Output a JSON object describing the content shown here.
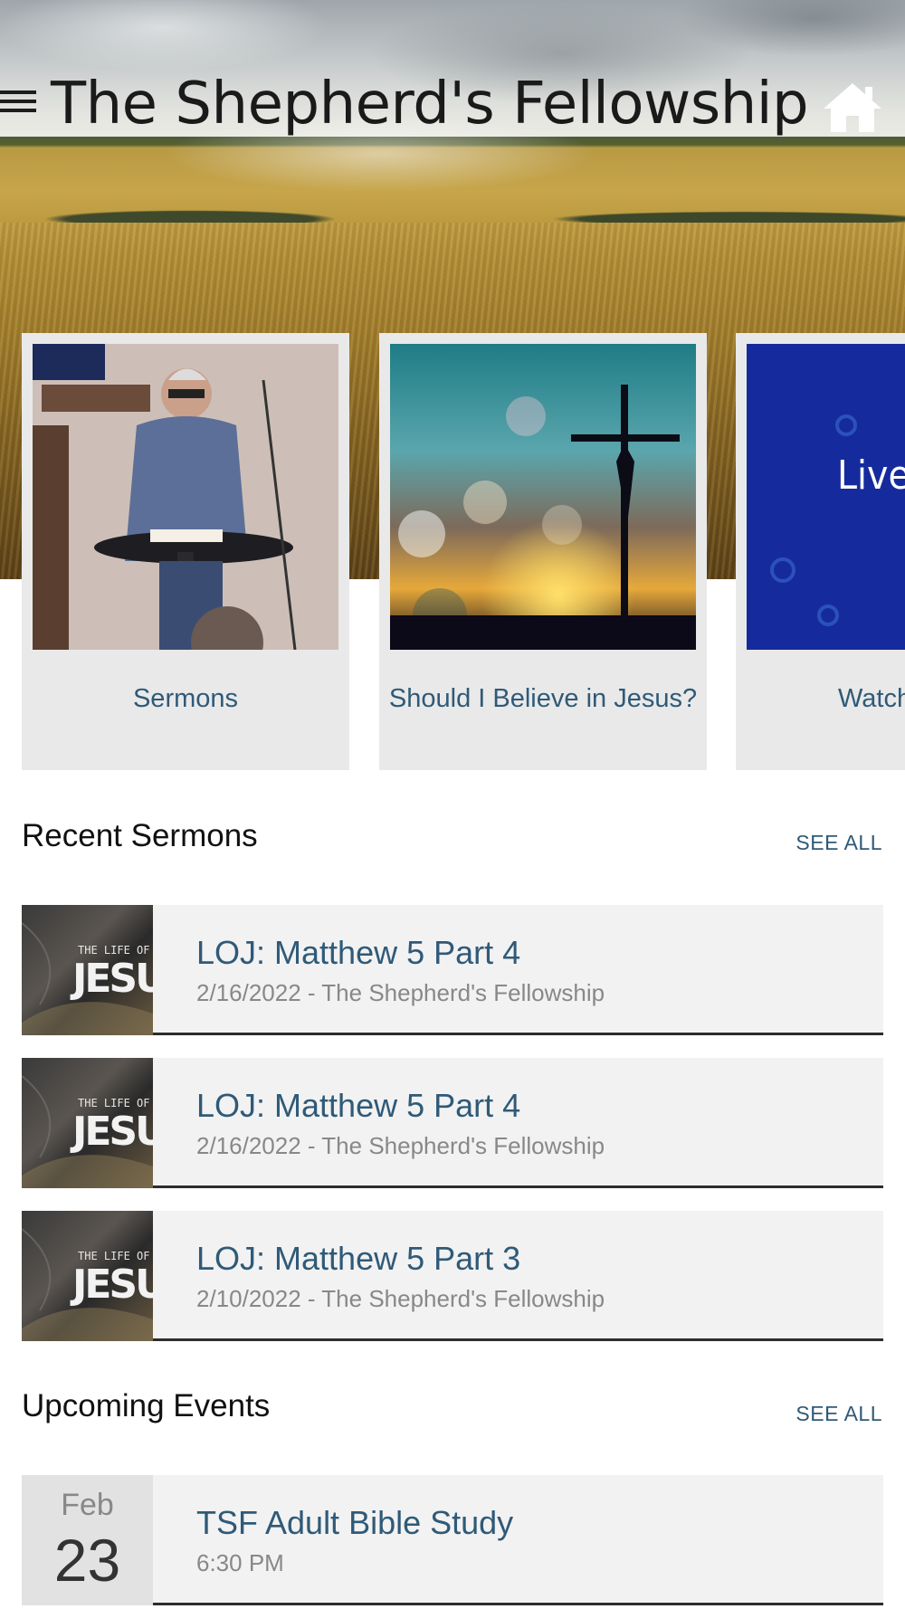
{
  "header": {
    "title": "The Shepherd's Fellowship",
    "menu_icon": "hamburger-menu-icon",
    "home_icon": "home-icon"
  },
  "carousel": {
    "cards": [
      {
        "label": "Sermons",
        "image": "pastor preaching photo"
      },
      {
        "label": "Should I Believe in Jesus?",
        "image": "cross at sunset photo"
      },
      {
        "label": "Watch",
        "image_text": "Live"
      }
    ]
  },
  "recent_sermons": {
    "title": "Recent Sermons",
    "see_all": "SEE ALL",
    "thumb_text": {
      "top": "THE LIFE OF",
      "main": "JESUS"
    },
    "items": [
      {
        "title": "LOJ: Matthew 5 Part 4",
        "subtitle": "2/16/2022 - The Shepherd's Fellowship"
      },
      {
        "title": "LOJ: Matthew 5 Part 4",
        "subtitle": "2/16/2022 - The Shepherd's Fellowship"
      },
      {
        "title": "LOJ: Matthew 5 Part 3",
        "subtitle": "2/10/2022 - The Shepherd's Fellowship"
      }
    ]
  },
  "upcoming_events": {
    "title": "Upcoming Events",
    "see_all": "SEE ALL",
    "items": [
      {
        "month": "Feb",
        "day": "23",
        "title": "TSF Adult Bible Study",
        "time": "6:30 PM"
      }
    ]
  },
  "colors": {
    "link": "#2f5a78",
    "card_bg": "#e9e9e9",
    "row_bg": "#f2f2f2"
  }
}
